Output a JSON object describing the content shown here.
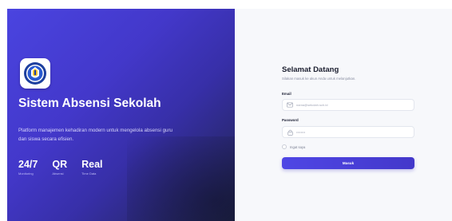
{
  "brand": {
    "title": "Sistem Absensi Sekolah",
    "description": "Platform manajemen kehadiran modern untuk mengelola absensi guru dan siswa secara efisien."
  },
  "stats": [
    {
      "value": "24/7",
      "label": "Monitoring"
    },
    {
      "value": "QR",
      "label": "Absensi"
    },
    {
      "value": "Real",
      "label": "Time Data"
    }
  ],
  "login": {
    "title": "Selamat Datang",
    "subtitle": "Silakan masuk ke akun Anda untuk melanjutkan.",
    "email_label": "Email",
    "email_placeholder": "nama@sekolah.sch.id",
    "password_label": "Password",
    "password_value": "••••••••",
    "remember_label": "Ingat saya",
    "submit_label": "Masuk"
  },
  "icons": {
    "logo": "school-emblem-icon",
    "email": "mail-icon",
    "password": "lock-icon"
  },
  "colors": {
    "primary": "#4f46e5",
    "panel_dark": "#1f2348",
    "background": "#f7f8fb"
  }
}
